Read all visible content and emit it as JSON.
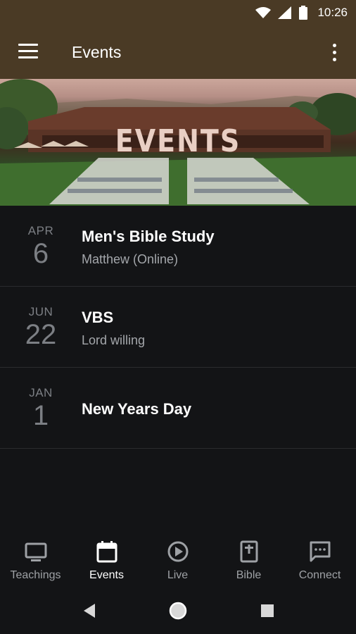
{
  "status_bar": {
    "time": "10:26",
    "icons": [
      "wifi-icon",
      "signal-icon",
      "battery-icon"
    ]
  },
  "app_bar": {
    "title": "Events",
    "menu_icon": "menu-icon",
    "more_icon": "more-vert-icon"
  },
  "hero": {
    "title": "EVENTS"
  },
  "events": [
    {
      "month": "APR",
      "day": "6",
      "title": "Men's Bible Study",
      "subtitle": "Matthew (Online)"
    },
    {
      "month": "JUN",
      "day": "22",
      "title": "VBS",
      "subtitle": "Lord willing"
    },
    {
      "month": "JAN",
      "day": "1",
      "title": "New Years Day",
      "subtitle": ""
    }
  ],
  "bottom_nav": {
    "active": "Events",
    "items": [
      {
        "label": "Teachings",
        "icon": "tv-icon"
      },
      {
        "label": "Events",
        "icon": "calendar-icon"
      },
      {
        "label": "Live",
        "icon": "play-circle-icon"
      },
      {
        "label": "Bible",
        "icon": "bible-icon"
      },
      {
        "label": "Connect",
        "icon": "chat-icon"
      }
    ]
  },
  "system_nav": {
    "icons": [
      "back-icon",
      "home-icon",
      "recents-icon"
    ]
  },
  "colors": {
    "app_bar": "#4a3a25",
    "background": "#131416",
    "date_text": "#7c7f84",
    "subtitle_text": "#a4a7ab"
  }
}
